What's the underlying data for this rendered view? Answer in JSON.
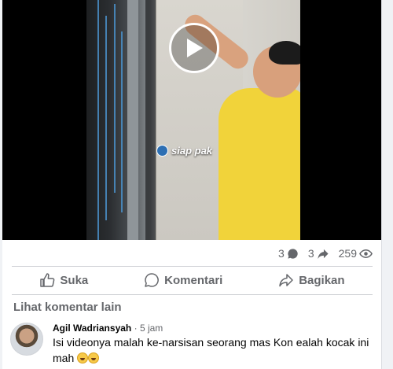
{
  "video": {
    "caption": "siap pak",
    "play_icon": "play-icon"
  },
  "stats": {
    "comments": "3",
    "shares": "3",
    "views": "259"
  },
  "actions": {
    "like": "Suka",
    "comment": "Komentari",
    "share": "Bagikan"
  },
  "more_comments": "Lihat komentar lain",
  "comment": {
    "author": "Agil Wadriansyah",
    "separator": "·",
    "time": "5 jam",
    "text": "Isi videonya malah ke-narsisan seorang mas Kon ealah kocak ini mah"
  },
  "colors": {
    "muted": "#65676b",
    "shirt": "#f1d33a",
    "background": "#f0f2f5"
  }
}
